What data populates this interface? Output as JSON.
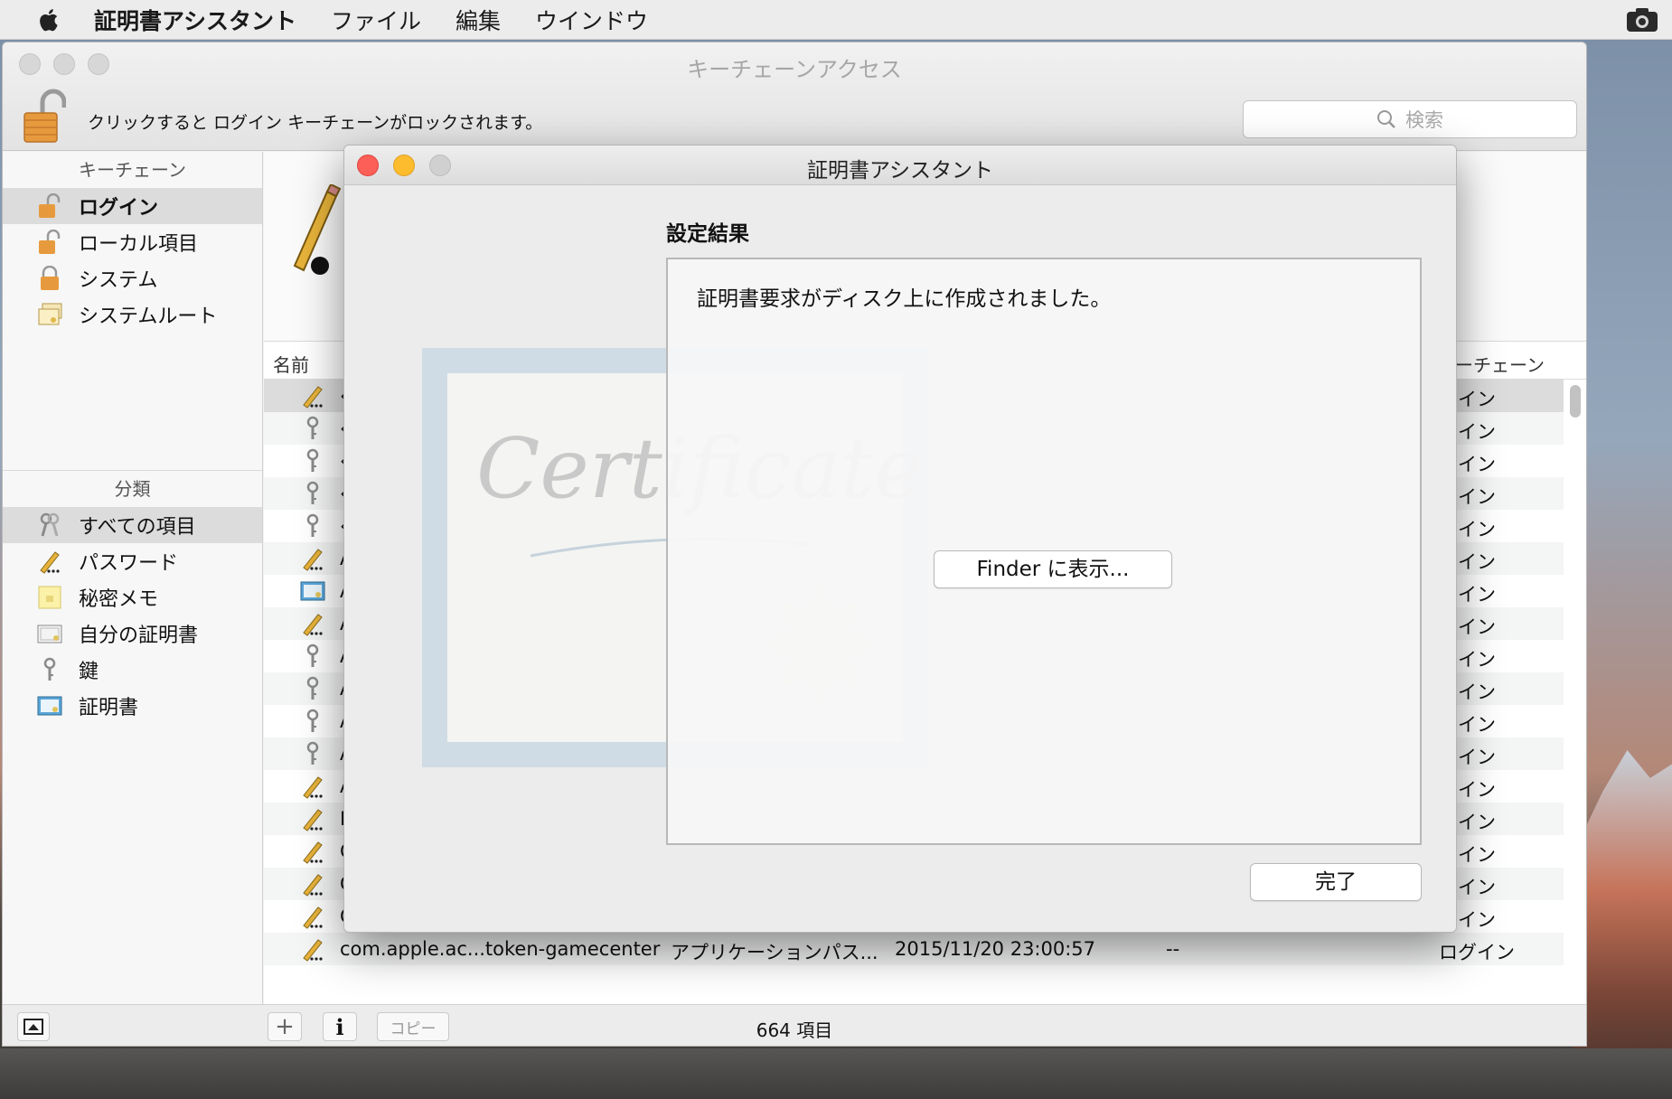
{
  "menubar": {
    "app": "証明書アシスタント",
    "items": [
      "ファイル",
      "編集",
      "ウインドウ"
    ]
  },
  "keychain_window": {
    "title": "キーチェーンアクセス",
    "lock_message": "クリックすると ログイン キーチェーンがロックされます。",
    "search_placeholder": "検索",
    "sidebar": {
      "keychains_header": "キーチェーン",
      "keychains": [
        {
          "label": "ログイン",
          "icon": "lock-open-icon",
          "selected": true
        },
        {
          "label": "ローカル項目",
          "icon": "lock-open-icon",
          "selected": false
        },
        {
          "label": "システム",
          "icon": "lock-icon",
          "selected": false
        },
        {
          "label": "システムルート",
          "icon": "certificates-icon",
          "selected": false
        }
      ],
      "categories_header": "分類",
      "categories": [
        {
          "label": "すべての項目",
          "icon": "keys-icon",
          "selected": true
        },
        {
          "label": "パスワード",
          "icon": "pencil-icon",
          "selected": false
        },
        {
          "label": "秘密メモ",
          "icon": "note-icon",
          "selected": false
        },
        {
          "label": "自分の証明書",
          "icon": "my-certificate-icon",
          "selected": false
        },
        {
          "label": "鍵",
          "icon": "key-icon",
          "selected": false
        },
        {
          "label": "証明書",
          "icon": "certificate-icon",
          "selected": false
        }
      ]
    },
    "columns": {
      "name": "名前",
      "keychain_partial": "ーチェーン"
    },
    "rows": [
      {
        "icon": "pencil-icon",
        "name": "‹",
        "kind": "",
        "date": "",
        "expires": "",
        "keychain": "グイン",
        "selected": true
      },
      {
        "icon": "key-icon",
        "name": "‹",
        "kind": "",
        "date": "",
        "expires": "",
        "keychain": "グイン"
      },
      {
        "icon": "key-icon",
        "name": "‹",
        "kind": "",
        "date": "",
        "expires": "",
        "keychain": "グイン"
      },
      {
        "icon": "key-icon",
        "name": "‹",
        "kind": "",
        "date": "",
        "expires": "",
        "keychain": "グイン"
      },
      {
        "icon": "key-icon",
        "name": "‹",
        "kind": "",
        "date": "",
        "expires": "",
        "keychain": "グイン"
      },
      {
        "icon": "pencil-icon",
        "name": "A",
        "kind": "",
        "date": "",
        "expires": "",
        "keychain": "グイン"
      },
      {
        "icon": "certificate-icon",
        "name": "A",
        "kind": "",
        "date": "",
        "expires": "",
        "keychain": "グイン"
      },
      {
        "icon": "pencil-icon",
        "name": "A",
        "kind": "",
        "date": "",
        "expires": "",
        "keychain": "グイン"
      },
      {
        "icon": "key-icon",
        "name": "A",
        "kind": "",
        "date": "",
        "expires": "",
        "keychain": "グイン"
      },
      {
        "icon": "key-icon",
        "name": "A",
        "kind": "",
        "date": "",
        "expires": "",
        "keychain": "グイン"
      },
      {
        "icon": "key-icon",
        "name": "A",
        "kind": "",
        "date": "",
        "expires": "",
        "keychain": "グイン"
      },
      {
        "icon": "key-icon",
        "name": "A",
        "kind": "",
        "date": "",
        "expires": "",
        "keychain": "グイン"
      },
      {
        "icon": "pencil-icon",
        "name": "A",
        "kind": "",
        "date": "",
        "expires": "",
        "keychain": "グイン"
      },
      {
        "icon": "pencil-icon",
        "name": "B",
        "kind": "",
        "date": "",
        "expires": "",
        "keychain": "グイン"
      },
      {
        "icon": "pencil-icon",
        "name": "C",
        "kind": "",
        "date": "",
        "expires": "",
        "keychain": "グイン"
      },
      {
        "icon": "pencil-icon",
        "name": "C",
        "kind": "",
        "date": "",
        "expires": "",
        "keychain": "グイン"
      },
      {
        "icon": "pencil-icon",
        "name": "C",
        "kind": "",
        "date": "",
        "expires": "",
        "keychain": "グイン"
      },
      {
        "icon": "pencil-icon",
        "name": "com.apple.ac...token-gamecenter",
        "kind": "アプリケーションパス...",
        "date": "2015/11/20 23:00:57",
        "expires": "--",
        "keychain": "ログイン"
      }
    ],
    "bottom": {
      "copy_label": "コピー",
      "info_label": "i",
      "add_label": "+",
      "item_count": "664 項目"
    }
  },
  "dialog": {
    "title": "証明書アシスタント",
    "section_title": "設定結果",
    "result_message": "証明書要求がディスク上に作成されました。",
    "finder_button": "Finder に表示...",
    "done_button": "完了",
    "watermark_text": "Certificate"
  },
  "colors": {
    "close": "#fc5f57",
    "minimize": "#fdbc2e",
    "inactive": "#d0d0d0",
    "selection": "#dcdcdc"
  }
}
